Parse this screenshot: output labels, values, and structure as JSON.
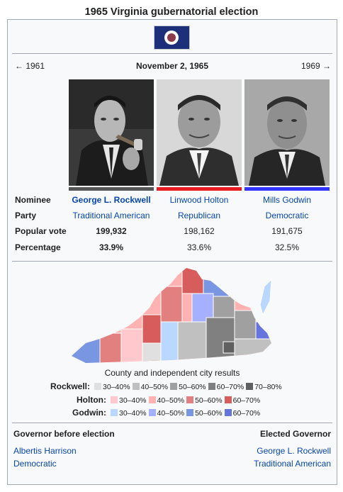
{
  "title": "1965 Virginia gubernatorial election",
  "nav": {
    "prev": "← 1961",
    "date": "November 2, 1965",
    "next": "1969 →"
  },
  "labels": {
    "nominee": "Nominee",
    "party": "Party",
    "popular": "Popular vote",
    "percentage": "Percentage"
  },
  "candidates": [
    {
      "name": "George L. Rockwell",
      "party": "Traditional American",
      "votes": "199,932",
      "pct": "33.9%",
      "color": "#555555",
      "winner": true
    },
    {
      "name": "Linwood Holton",
      "party": "Republican",
      "votes": "198,162",
      "pct": "33.6%",
      "color": "#e81b23",
      "winner": false
    },
    {
      "name": "Mills Godwin",
      "party": "Democratic",
      "votes": "191,675",
      "pct": "32.5%",
      "color": "#3333ff",
      "winner": false
    }
  ],
  "map_caption": "County and independent city results",
  "legend": {
    "rockwell": {
      "label": "Rockwell:",
      "bins": [
        "30–40%",
        "40–50%",
        "50–60%",
        "60–70%",
        "70–80%"
      ],
      "colors": [
        "#e0e0e0",
        "#c0c0c0",
        "#a0a0a0",
        "#808080",
        "#606060"
      ]
    },
    "holton": {
      "label": "Holton:",
      "bins": [
        "30–40%",
        "40–50%",
        "50–60%",
        "60–70%"
      ],
      "colors": [
        "#ffc8cd",
        "#ffb2b2",
        "#e27f7f",
        "#d75d5d"
      ]
    },
    "godwin": {
      "label": "Godwin:",
      "bins": [
        "30–40%",
        "40–50%",
        "50–60%",
        "60–70%"
      ],
      "colors": [
        "#b9d7ff",
        "#a5b0ff",
        "#7996e2",
        "#6674de"
      ]
    }
  },
  "footer": {
    "before_heading": "Governor before election",
    "after_heading": "Elected Governor",
    "before_name": "Albertis Harrison",
    "before_party": "Democratic",
    "after_name": "George L. Rockwell",
    "after_party": "Traditional American"
  }
}
